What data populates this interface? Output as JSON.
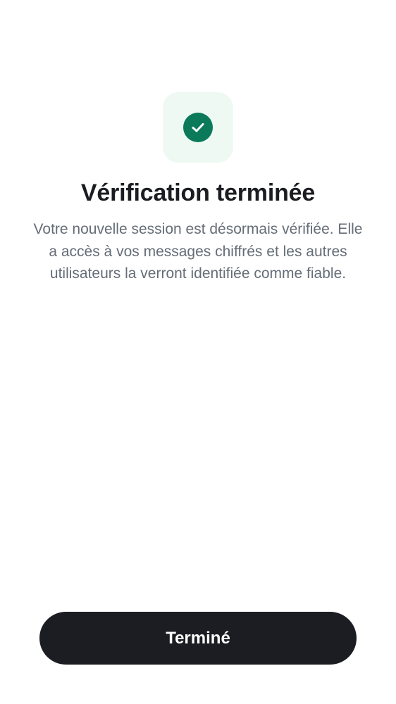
{
  "screen": {
    "icon": "check-circle-icon",
    "title": "Vérification terminée",
    "message": "Votre nouvelle session est désormais vérifiée. Elle a accès à vos messages chiffrés et les autres utilisateurs la verront identifiée comme fiable.",
    "done_label": "Terminé"
  },
  "colors": {
    "accent": "#0b7a5a",
    "icon_background": "#eef9f3",
    "title_text": "#1b1d22",
    "body_text": "#656d77",
    "button_background": "#1b1d22",
    "button_text": "#ffffff"
  }
}
